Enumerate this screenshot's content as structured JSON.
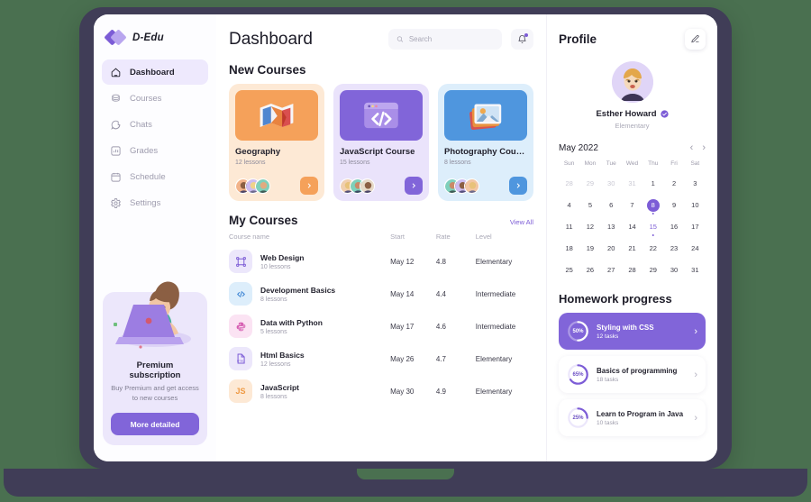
{
  "brand": {
    "name": "D-Edu",
    "logo_icon": "diamond-logo"
  },
  "sidebar": {
    "items": [
      {
        "label": "Dashboard",
        "icon": "home-icon",
        "active": true
      },
      {
        "label": "Courses",
        "icon": "book-icon",
        "active": false
      },
      {
        "label": "Chats",
        "icon": "chat-bubble-icon",
        "active": false
      },
      {
        "label": "Grades",
        "icon": "bar-chart-icon",
        "active": false
      },
      {
        "label": "Schedule",
        "icon": "calendar-icon",
        "active": false
      },
      {
        "label": "Settings",
        "icon": "gear-icon",
        "active": false
      }
    ],
    "promo": {
      "title": "Premium subscription",
      "subtitle": "Buy Premium and get access to new courses",
      "button": "More detailed"
    }
  },
  "header": {
    "title": "Dashboard",
    "search_placeholder": "Search",
    "search_value": "",
    "search_icon": "search-icon",
    "bell_icon": "bell-icon",
    "bell_has_badge": true
  },
  "new_courses": {
    "title": "New Courses",
    "cards": [
      {
        "name": "Geography",
        "lessons": "12 lessons",
        "thumb_icon": "map-icon",
        "card_bg": "#fde9d5",
        "thumb_bg": "#f5a15a",
        "btn_bg": "#f5a15a"
      },
      {
        "name": "JavaScript Course",
        "lessons": "15 lessons",
        "thumb_icon": "code-window-icon",
        "card_bg": "#eae3fb",
        "thumb_bg": "#8165d9",
        "btn_bg": "#8165d9"
      },
      {
        "name": "Photography Course",
        "lessons": "8 lessons",
        "thumb_icon": "photo-icon",
        "card_bg": "#ddeefb",
        "thumb_bg": "#4f96de",
        "btn_bg": "#4f96de"
      }
    ]
  },
  "my_courses": {
    "title": "My Courses",
    "view_all": "View All",
    "columns": [
      "Course name",
      "Start",
      "Rate",
      "Level"
    ],
    "rows": [
      {
        "name": "Web Design",
        "lessons": "10 lessons",
        "start": "May 12",
        "rate": "4.8",
        "level": "Elementary",
        "icon": "frame-icon",
        "icon_bg": "#ece7fb",
        "icon_color": "#7c5cd6"
      },
      {
        "name": "Development Basics",
        "lessons": "8 lessons",
        "start": "May 14",
        "rate": "4.4",
        "level": "Intermediate",
        "icon": "code-icon",
        "icon_bg": "#ddeefb",
        "icon_color": "#3f86d4"
      },
      {
        "name": "Data with Python",
        "lessons": "5 lessons",
        "start": "May 17",
        "rate": "4.6",
        "level": "Intermediate",
        "icon": "python-icon",
        "icon_bg": "#fbe3f3",
        "icon_color": "#d660b3"
      },
      {
        "name": "Html Basics",
        "lessons": "12 lessons",
        "start": "May 26",
        "rate": "4.7",
        "level": "Elementary",
        "icon": "html-file-icon",
        "icon_bg": "#ece7fb",
        "icon_color": "#7c5cd6"
      },
      {
        "name": "JavaScript",
        "lessons": "8 lessons",
        "start": "May 30",
        "rate": "4.9",
        "level": "Elementary",
        "icon": "js-icon",
        "icon_bg": "#fde9d5",
        "icon_color": "#ef9a43"
      }
    ]
  },
  "profile": {
    "title": "Profile",
    "edit_icon": "pencil-icon",
    "avatar_icon": "user-avatar",
    "name": "Esther Howard",
    "verified": true,
    "role": "Elementary"
  },
  "calendar": {
    "month": "May 2022",
    "prev_icon": "chevron-left-icon",
    "next_icon": "chevron-right-icon",
    "weekdays": [
      "Sun",
      "Mon",
      "Tue",
      "Wed",
      "Thu",
      "Fri",
      "Sat"
    ],
    "weeks": [
      [
        {
          "d": "28",
          "muted": true
        },
        {
          "d": "29",
          "muted": true
        },
        {
          "d": "30",
          "muted": true
        },
        {
          "d": "31",
          "muted": true
        },
        {
          "d": "1"
        },
        {
          "d": "2"
        },
        {
          "d": "3"
        }
      ],
      [
        {
          "d": "4"
        },
        {
          "d": "5"
        },
        {
          "d": "6"
        },
        {
          "d": "7"
        },
        {
          "d": "8",
          "selected": true,
          "dot": true
        },
        {
          "d": "9"
        },
        {
          "d": "10"
        }
      ],
      [
        {
          "d": "11"
        },
        {
          "d": "12"
        },
        {
          "d": "13"
        },
        {
          "d": "14"
        },
        {
          "d": "15",
          "highlight": true,
          "dot": true
        },
        {
          "d": "16"
        },
        {
          "d": "17"
        }
      ],
      [
        {
          "d": "18"
        },
        {
          "d": "19"
        },
        {
          "d": "20"
        },
        {
          "d": "21"
        },
        {
          "d": "22"
        },
        {
          "d": "23"
        },
        {
          "d": "24"
        }
      ],
      [
        {
          "d": "25"
        },
        {
          "d": "26"
        },
        {
          "d": "27"
        },
        {
          "d": "28"
        },
        {
          "d": "29"
        },
        {
          "d": "30"
        },
        {
          "d": "31"
        }
      ]
    ]
  },
  "homework": {
    "title": "Homework progress",
    "items": [
      {
        "name": "Styling with CSS",
        "tasks": "12 tasks",
        "percent": 50,
        "percent_label": "50%",
        "active": true
      },
      {
        "name": "Basics of programming",
        "tasks": "18 tasks",
        "percent": 65,
        "percent_label": "65%",
        "active": false
      },
      {
        "name": "Learn to Program in Java",
        "tasks": "10 tasks",
        "percent": 25,
        "percent_label": "25%",
        "active": false
      }
    ]
  },
  "colors": {
    "background": "#4a7050",
    "device_frame": "#403d57",
    "accent_purple": "#7c5cd6",
    "accent_orange": "#f5a15a",
    "accent_blue": "#4f96de"
  }
}
